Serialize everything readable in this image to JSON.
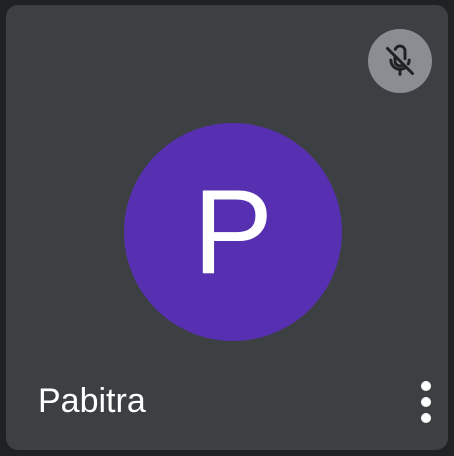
{
  "participant": {
    "name": "Pabitra",
    "initial": "P",
    "avatar_color": "#5630b0",
    "tile_color": "#3c4043",
    "muted": true
  },
  "icons": {
    "mute_status": "microphone-off-icon",
    "more_options": "more-vertical-icon"
  },
  "colors": {
    "mute_badge_bg": "#8a8d91",
    "text": "#ffffff",
    "page_bg": "#202124"
  }
}
